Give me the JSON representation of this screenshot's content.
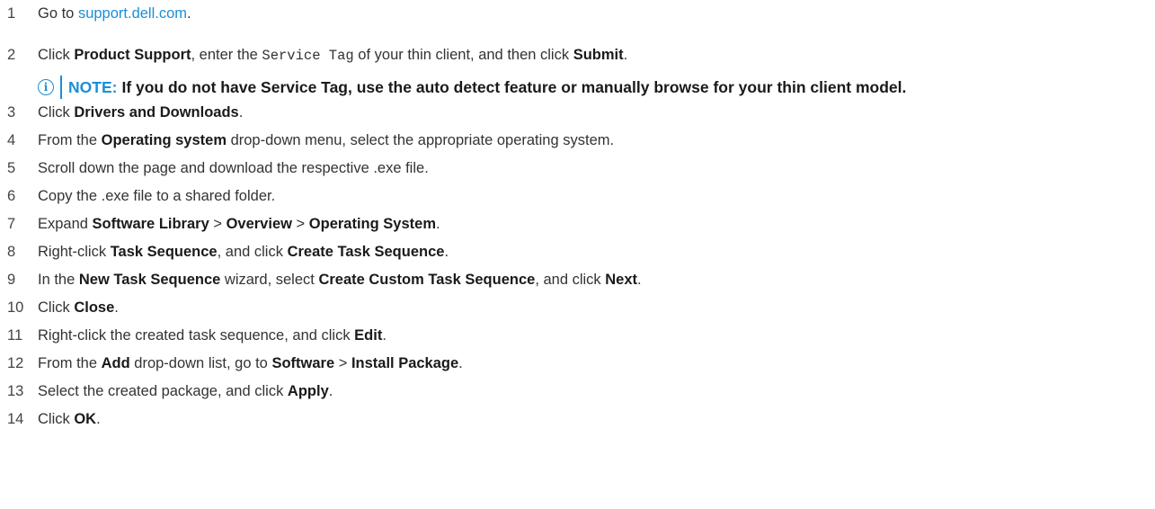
{
  "steps": [
    {
      "num": "1",
      "parts": [
        {
          "t": "Go to "
        },
        {
          "t": "support.dell.com",
          "s": "link"
        },
        {
          "t": "."
        }
      ]
    },
    {
      "num": "2",
      "parts": [
        {
          "t": "Click "
        },
        {
          "t": "Product Support",
          "s": "b"
        },
        {
          "t": ", enter the "
        },
        {
          "t": "Service Tag",
          "s": "mono"
        },
        {
          "t": " of your thin client, and then click "
        },
        {
          "t": "Submit",
          "s": "b"
        },
        {
          "t": "."
        }
      ]
    },
    {
      "num": "3",
      "parts": [
        {
          "t": "Click "
        },
        {
          "t": "Drivers and Downloads",
          "s": "b"
        },
        {
          "t": "."
        }
      ]
    },
    {
      "num": "4",
      "parts": [
        {
          "t": "From the "
        },
        {
          "t": "Operating system",
          "s": "b"
        },
        {
          "t": " drop-down menu, select the appropriate operating system."
        }
      ]
    },
    {
      "num": "5",
      "parts": [
        {
          "t": "Scroll down the page and download the respective .exe file."
        }
      ]
    },
    {
      "num": "6",
      "parts": [
        {
          "t": "Copy the .exe file to a shared folder."
        }
      ]
    },
    {
      "num": "7",
      "parts": [
        {
          "t": "Expand "
        },
        {
          "t": "Software Library",
          "s": "b"
        },
        {
          "t": " > "
        },
        {
          "t": "Overview",
          "s": "b"
        },
        {
          "t": " > "
        },
        {
          "t": "Operating System",
          "s": "b"
        },
        {
          "t": "."
        }
      ]
    },
    {
      "num": "8",
      "parts": [
        {
          "t": "Right-click "
        },
        {
          "t": "Task Sequence",
          "s": "b"
        },
        {
          "t": ", and click "
        },
        {
          "t": "Create Task Sequence",
          "s": "b"
        },
        {
          "t": "."
        }
      ]
    },
    {
      "num": "9",
      "parts": [
        {
          "t": "In the "
        },
        {
          "t": "New Task Sequence",
          "s": "b"
        },
        {
          "t": " wizard, select "
        },
        {
          "t": "Create Custom Task Sequence",
          "s": "b"
        },
        {
          "t": ", and click "
        },
        {
          "t": "Next",
          "s": "b"
        },
        {
          "t": "."
        }
      ]
    },
    {
      "num": "10",
      "parts": [
        {
          "t": "Click "
        },
        {
          "t": "Close",
          "s": "b"
        },
        {
          "t": "."
        }
      ]
    },
    {
      "num": "11",
      "parts": [
        {
          "t": "Right-click the created task sequence, and click "
        },
        {
          "t": "Edit",
          "s": "b"
        },
        {
          "t": "."
        }
      ]
    },
    {
      "num": "12",
      "parts": [
        {
          "t": "From the "
        },
        {
          "t": "Add",
          "s": "b"
        },
        {
          "t": " drop-down list, go to "
        },
        {
          "t": "Software",
          "s": "b"
        },
        {
          "t": " > "
        },
        {
          "t": "Install Package",
          "s": "b"
        },
        {
          "t": "."
        }
      ]
    },
    {
      "num": "13",
      "parts": [
        {
          "t": "Select the created package, and click "
        },
        {
          "t": "Apply",
          "s": "b"
        },
        {
          "t": "."
        }
      ]
    },
    {
      "num": "14",
      "parts": [
        {
          "t": "Click "
        },
        {
          "t": "OK",
          "s": "b"
        },
        {
          "t": "."
        }
      ]
    }
  ],
  "note": {
    "icon": "info-icon",
    "icon_glyph": "i",
    "label": "NOTE:",
    "text": "If you do not have Service Tag, use the auto detect feature or manually browse for your thin client model."
  },
  "colors": {
    "link": "#1a8fd6",
    "note_accent": "#1a8fd6"
  }
}
